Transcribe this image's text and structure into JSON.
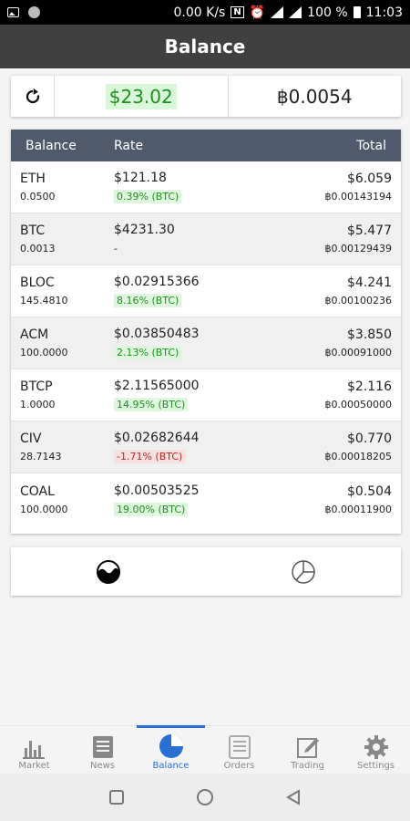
{
  "status_bar": {
    "speed": "0.00 K/s",
    "battery": "100 %",
    "time": "11:03"
  },
  "header": {
    "title": "Balance"
  },
  "summary": {
    "usd_total": "$23.02",
    "btc_total": "฿0.0054"
  },
  "table": {
    "headers": {
      "balance": "Balance",
      "rate": "Rate",
      "total": "Total"
    },
    "rows": [
      {
        "coin": "ETH",
        "amount": "0.0500",
        "rate": "$121.18",
        "change": "0.39% (BTC)",
        "usd": "$6.059",
        "btc": "฿0.00143194"
      },
      {
        "coin": "BTC",
        "amount": "0.0013",
        "rate": "$4231.30",
        "change": "-",
        "usd": "$5.477",
        "btc": "฿0.00129439"
      },
      {
        "coin": "BLOC",
        "amount": "145.4810",
        "rate": "$0.02915366",
        "change": "8.16% (BTC)",
        "usd": "$4.241",
        "btc": "฿0.00100236"
      },
      {
        "coin": "ACM",
        "amount": "100.0000",
        "rate": "$0.03850483",
        "change": "2.13% (BTC)",
        "usd": "$3.850",
        "btc": "฿0.00091000"
      },
      {
        "coin": "BTCP",
        "amount": "1.0000",
        "rate": "$2.11565000",
        "change": "14.95% (BTC)",
        "usd": "$2.116",
        "btc": "฿0.00050000"
      },
      {
        "coin": "CIV",
        "amount": "28.7143",
        "rate": "$0.02682644",
        "change": "-1.71% (BTC)",
        "usd": "$0.770",
        "btc": "฿0.00018205"
      },
      {
        "coin": "COAL",
        "amount": "100.0000",
        "rate": "$0.00503525",
        "change": "19.00% (BTC)",
        "usd": "$0.504",
        "btc": "฿0.00011900"
      }
    ]
  },
  "chart_toggle": {
    "left_icon": "half-filled-circle-icon",
    "right_icon": "pie-chart-icon"
  },
  "bottom_nav": {
    "items": [
      {
        "label": "Market",
        "icon": "bar-chart-icon"
      },
      {
        "label": "News",
        "icon": "newspaper-icon"
      },
      {
        "label": "Balance",
        "icon": "pie-chart-icon"
      },
      {
        "label": "Orders",
        "icon": "list-icon"
      },
      {
        "label": "Trading",
        "icon": "edit-icon"
      },
      {
        "label": "Settings",
        "icon": "gear-icon"
      }
    ],
    "active": "Balance"
  },
  "colors": {
    "title_bar": "#404040",
    "table_header": "#4f5b6d",
    "positive": "#1f8f1f",
    "negative": "#b02a2a",
    "accent": "#2a6fd6"
  }
}
